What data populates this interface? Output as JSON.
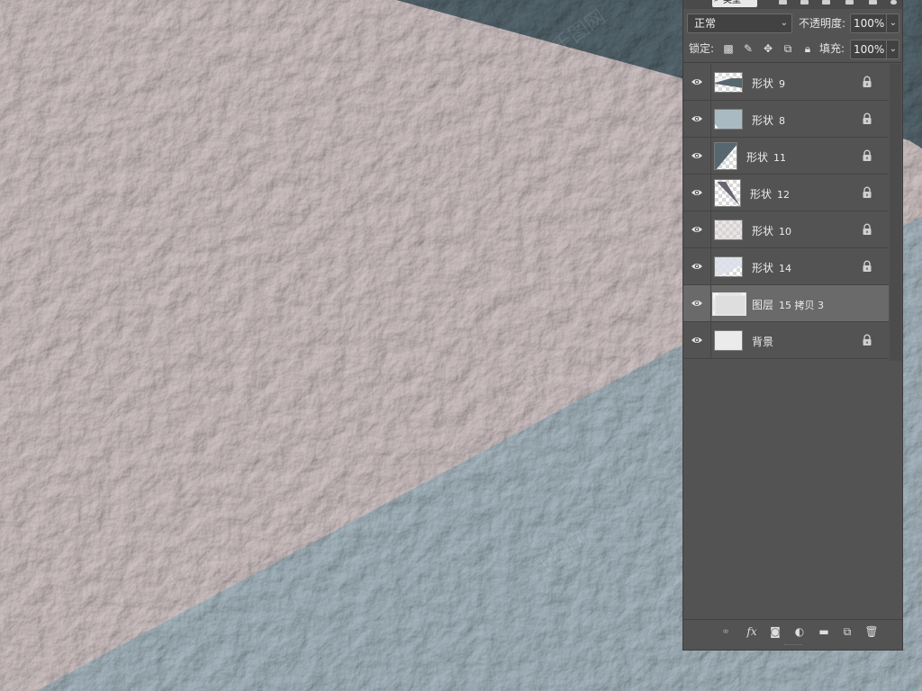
{
  "panel": {
    "filter": {
      "label": "类型"
    },
    "blend_mode": "正常",
    "opacity_label": "不透明度:",
    "opacity_value": "100%",
    "lock_label": "锁定:",
    "fill_label": "填充:",
    "fill_value": "100%"
  },
  "layers": [
    {
      "name": "形状",
      "num": "9",
      "locked": true
    },
    {
      "name": "形状",
      "num": "8",
      "locked": true
    },
    {
      "name": "形状",
      "num": "11",
      "locked": true
    },
    {
      "name": "形状",
      "num": "12",
      "locked": true
    },
    {
      "name": "形状",
      "num": "10",
      "locked": true
    },
    {
      "name": "形状",
      "num": "14",
      "locked": true
    },
    {
      "name": "图层",
      "num": "15 拷贝 3",
      "locked": false,
      "selected": true
    },
    {
      "name": "背景",
      "num": "",
      "locked": true
    }
  ],
  "colors": {
    "canvas_pink": "#c9bcbd",
    "canvas_blue": "#9eafb8",
    "canvas_dark": "#4d5f67",
    "panel_bg": "#535353",
    "selected_row": "#6a6a6a"
  },
  "icons": {
    "visibility": "eye-icon",
    "lock": "padlock-icon",
    "link": "link-icon",
    "fx": "fx-icon",
    "mask": "mask-icon",
    "adjustment": "adjustment-icon",
    "group": "folder-icon",
    "new_layer": "new-layer-icon",
    "delete": "trash-icon"
  }
}
